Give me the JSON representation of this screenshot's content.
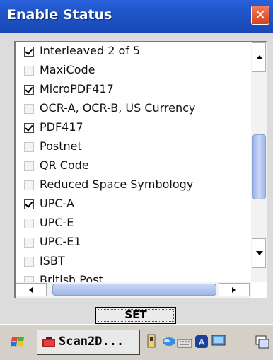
{
  "window": {
    "title": "Enable Status",
    "close_glyph": "✕"
  },
  "list": {
    "items": [
      {
        "label": "Interleaved 2 of 5",
        "checked": true
      },
      {
        "label": "MaxiCode",
        "checked": false
      },
      {
        "label": "MicroPDF417",
        "checked": true
      },
      {
        "label": "OCR-A, OCR-B, US Currency",
        "checked": false
      },
      {
        "label": "PDF417",
        "checked": true
      },
      {
        "label": "Postnet",
        "checked": false
      },
      {
        "label": "QR Code",
        "checked": false
      },
      {
        "label": "Reduced Space Symbology",
        "checked": false
      },
      {
        "label": "UPC-A",
        "checked": true
      },
      {
        "label": "UPC-E",
        "checked": false
      },
      {
        "label": "UPC-E1",
        "checked": false
      },
      {
        "label": "ISBT",
        "checked": false
      },
      {
        "label": "British Post",
        "checked": false
      }
    ]
  },
  "buttons": {
    "set_label": "SET"
  },
  "taskbar": {
    "app_label": "Scan2D...",
    "start_icon": "windows-flag-icon",
    "tray_icons": [
      "network-icon",
      "bluetooth-icon",
      "keyboard-input-icon",
      "security-icon",
      "monitor-icon"
    ],
    "right_icon": "input-panel-icon"
  },
  "colors": {
    "titlebar": "#1f55c8",
    "close": "#d6401f",
    "scroll_thumb": "#9fb6e8"
  }
}
